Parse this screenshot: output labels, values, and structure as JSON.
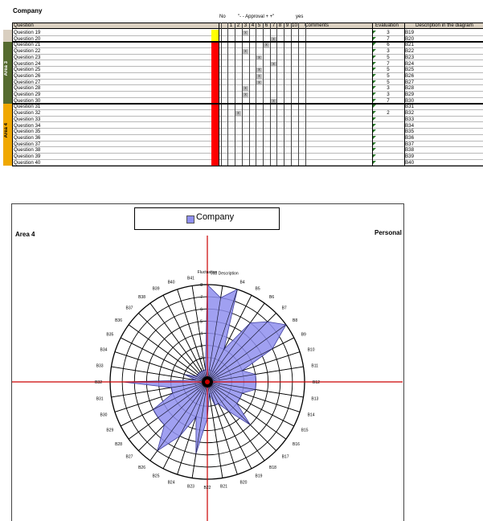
{
  "sheet": {
    "title": "Company",
    "header": {
      "no": "No",
      "approval": "\"- - Approval + +\"",
      "yes": "yes",
      "question_col": "Question",
      "scale": [
        "1",
        "2",
        "3",
        "4",
        "5",
        "6",
        "7",
        "8",
        "9",
        "10"
      ],
      "comments": "Comments",
      "evaluation": "Evaluation",
      "description": "Description in the diagram"
    },
    "areas": [
      {
        "label": "Area 3",
        "color": "#556b2f"
      },
      {
        "label": "Area 4",
        "color": "#f0a800"
      }
    ],
    "rows": [
      {
        "q": "Question 19",
        "x": 3,
        "eval": "3",
        "desc": "B19",
        "bar": "#ffff00"
      },
      {
        "q": "Question 20",
        "x": 7,
        "eval": "7",
        "desc": "B20",
        "bar": "#ffff00"
      },
      {
        "q": "Question 21",
        "x": 6,
        "eval": "6",
        "desc": "B21",
        "bar": "#ff0000"
      },
      {
        "q": "Question 22",
        "x": 3,
        "eval": "3",
        "desc": "B22",
        "bar": "#ff0000"
      },
      {
        "q": "Question 23",
        "x": 5,
        "eval": "5",
        "desc": "B23",
        "bar": "#ff0000"
      },
      {
        "q": "Question 24",
        "x": 7,
        "eval": "7",
        "desc": "B24",
        "bar": "#ff0000"
      },
      {
        "q": "Question 25",
        "x": 5,
        "eval": "5",
        "desc": "B25",
        "bar": "#ff0000"
      },
      {
        "q": "Question 26",
        "x": 5,
        "eval": "5",
        "desc": "B26",
        "bar": "#ff0000"
      },
      {
        "q": "Question 27",
        "x": 5,
        "eval": "5",
        "desc": "B27",
        "bar": "#ff0000"
      },
      {
        "q": "Question 28",
        "x": 3,
        "eval": "3",
        "desc": "B28",
        "bar": "#ff0000"
      },
      {
        "q": "Question 29",
        "x": 3,
        "eval": "3",
        "desc": "B29",
        "bar": "#ff0000"
      },
      {
        "q": "Question 30",
        "x": 7,
        "eval": "7",
        "desc": "B30",
        "bar": "#ff0000"
      },
      {
        "q": "Question 31",
        "x": null,
        "eval": "",
        "desc": "B31",
        "bar": "#ff0000"
      },
      {
        "q": "Question 32",
        "x": 2,
        "eval": "2",
        "desc": "B32",
        "bar": "#ff0000"
      },
      {
        "q": "Question 33",
        "x": null,
        "eval": "",
        "desc": "B33",
        "bar": "#ff0000"
      },
      {
        "q": "Question 34",
        "x": null,
        "eval": "",
        "desc": "B34",
        "bar": "#ff0000"
      },
      {
        "q": "Question 35",
        "x": null,
        "eval": "",
        "desc": "B35",
        "bar": "#ff0000"
      },
      {
        "q": "Question 36",
        "x": null,
        "eval": "",
        "desc": "B36",
        "bar": "#ff0000"
      },
      {
        "q": "Question 37",
        "x": null,
        "eval": "",
        "desc": "B37",
        "bar": "#ff0000"
      },
      {
        "q": "Question 38",
        "x": null,
        "eval": "",
        "desc": "B38",
        "bar": "#ff0000"
      },
      {
        "q": "Question 39",
        "x": null,
        "eval": "",
        "desc": "B39",
        "bar": "#ff0000"
      },
      {
        "q": "Question 40",
        "x": null,
        "eval": "",
        "desc": "B40",
        "bar": "#ff0000"
      }
    ],
    "x_mark": "x"
  },
  "chart_panel": {
    "legend": "Company",
    "left_tag": "Area 4",
    "right_tag": "Personal",
    "fill_color": "#8f8fef"
  },
  "chart_data": {
    "type": "radar",
    "series": [
      {
        "name": "Company",
        "values": [
          8,
          7,
          8,
          3,
          6,
          7,
          8,
          6,
          3,
          4,
          4,
          4,
          3,
          3,
          3,
          5,
          3,
          2,
          2,
          1,
          3,
          6,
          3,
          5,
          7,
          5,
          5,
          5,
          3,
          3,
          7,
          1,
          2,
          1,
          1,
          1,
          1,
          1,
          1,
          1
        ]
      }
    ],
    "categories": [
      "Fluctuation",
      "Job Description",
      "B4",
      "B5",
      "B6",
      "B7",
      "B8",
      "B9",
      "B10",
      "B11",
      "B12",
      "B13",
      "B14",
      "B15",
      "B16",
      "B17",
      "B18",
      "B19",
      "B20",
      "B21",
      "B22",
      "B23",
      "B24",
      "B25",
      "B26",
      "B27",
      "B28",
      "B29",
      "B30",
      "B31",
      "B32",
      "B33",
      "B34",
      "B35",
      "B36",
      "B37",
      "B38",
      "B39",
      "B40",
      "B41"
    ],
    "rmax": 8,
    "ring_labels": [
      "1",
      "2",
      "3",
      "4",
      "5",
      "6",
      "7",
      "8"
    ]
  }
}
